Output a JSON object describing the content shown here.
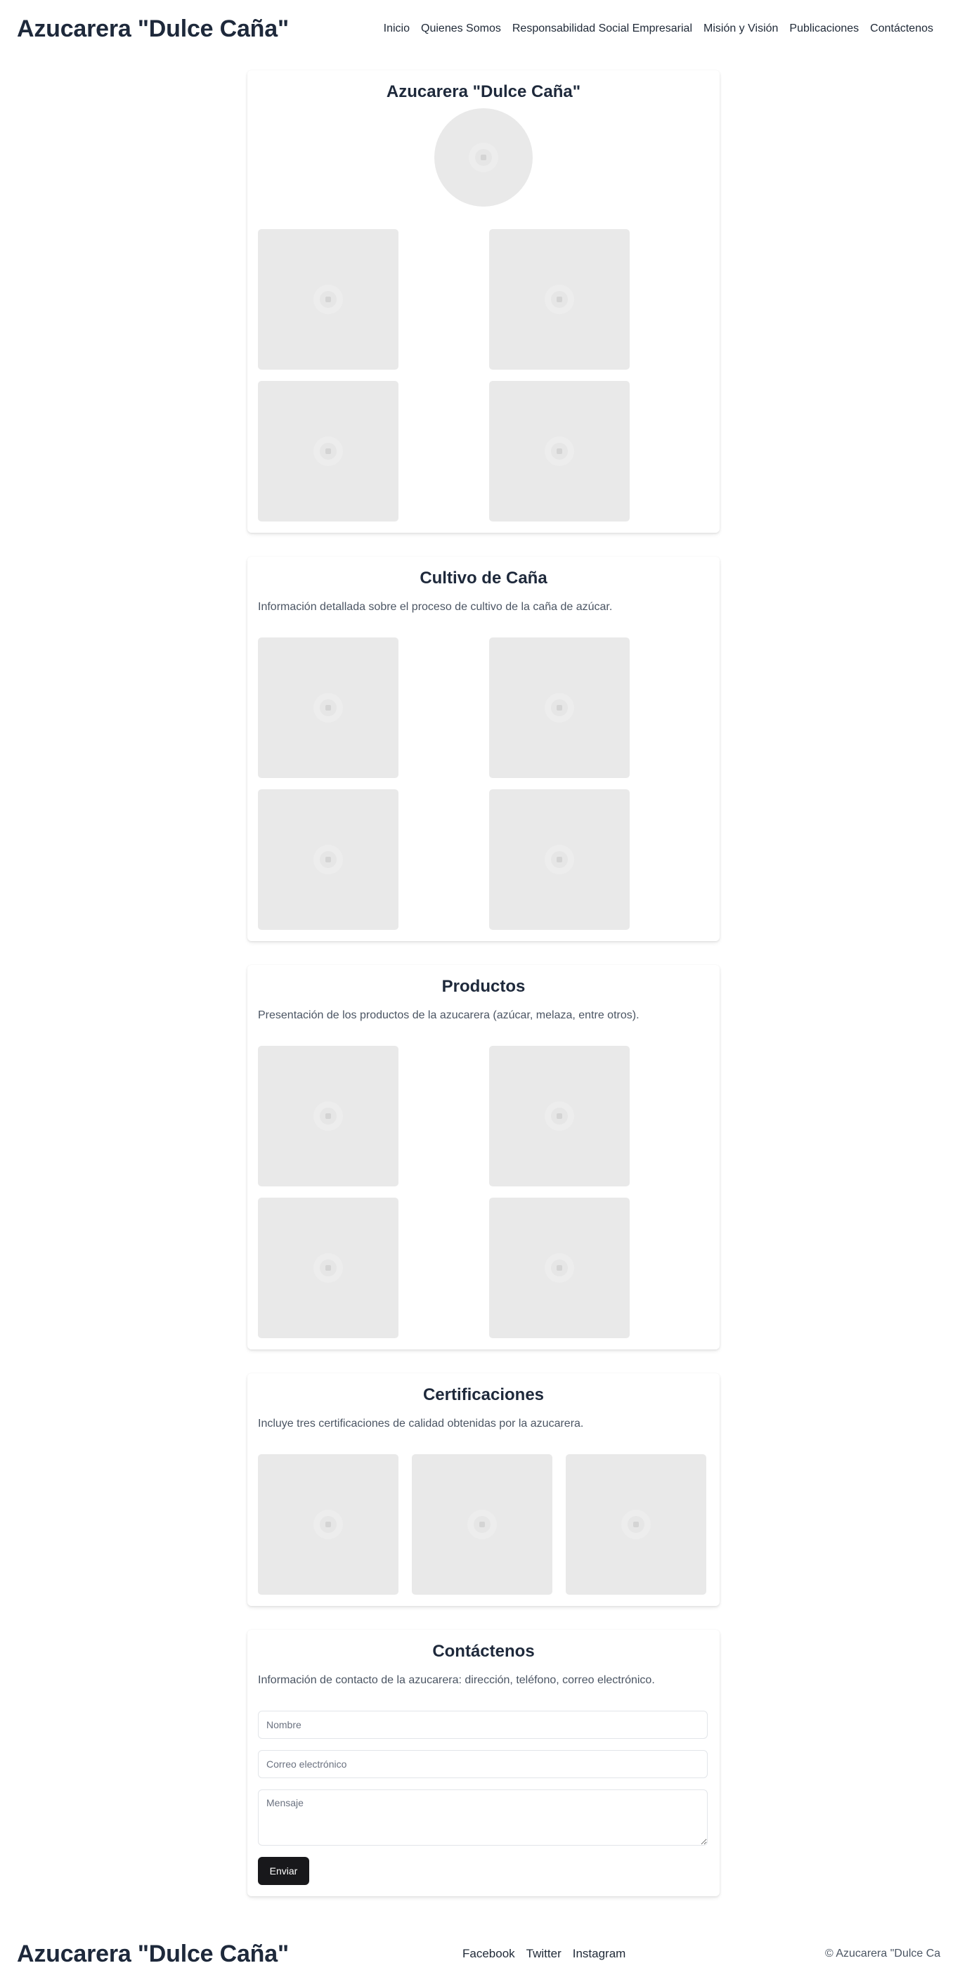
{
  "header": {
    "brand": "Azucarera \"Dulce Caña\"",
    "nav": [
      "Inicio",
      "Quienes Somos",
      "Responsabilidad Social Empresarial",
      "Misión y Visión",
      "Publicaciones",
      "Contáctenos"
    ]
  },
  "hero": {
    "title": "Azucarera \"Dulce Caña\""
  },
  "cultivo": {
    "title": "Cultivo de Caña",
    "description": "Información detallada sobre el proceso de cultivo de la caña de azúcar."
  },
  "productos": {
    "title": "Productos",
    "description": "Presentación de los productos de la azucarera (azúcar, melaza, entre otros)."
  },
  "certificaciones": {
    "title": "Certificaciones",
    "description": "Incluye tres certificaciones de calidad obtenidas por la azucarera."
  },
  "contacto": {
    "title": "Contáctenos",
    "description": "Información de contacto de la azucarera: dirección, teléfono, correo electrónico.",
    "name_placeholder": "Nombre",
    "email_placeholder": "Correo electrónico",
    "message_placeholder": "Mensaje",
    "submit_label": "Enviar"
  },
  "footer": {
    "brand": "Azucarera \"Dulce Caña\"",
    "links": [
      "Facebook",
      "Twitter",
      "Instagram"
    ],
    "copyright": "© Azucarera \"Dulce Ca"
  },
  "colors": {
    "text": "#1e293b",
    "muted": "#4b5563",
    "placeholder_bg": "#e9e9e9",
    "button_bg": "#18181b"
  },
  "icons": [
    "image-placeholder-icon"
  ]
}
